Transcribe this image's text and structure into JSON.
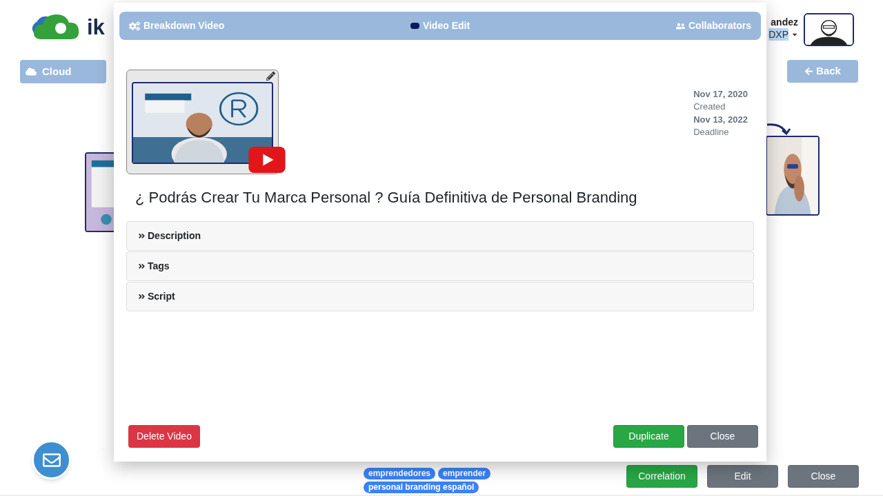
{
  "background": {
    "logo": {
      "text": "ik"
    },
    "user": {
      "name": "andez",
      "role": "DXP"
    },
    "cloud_button": "Cloud",
    "back_button": "Back",
    "tags": [
      "emprendedores",
      "emprender",
      "personal branding español"
    ],
    "buttons": [
      {
        "label": "Correlation",
        "kind": "success"
      },
      {
        "label": "Edit",
        "kind": "secondary"
      },
      {
        "label": "Close",
        "kind": "secondary"
      }
    ]
  },
  "modal": {
    "header_items": [
      "Breakdown Video",
      "Video Edit",
      "Collaborators"
    ],
    "dates": [
      {
        "value": "Nov 17, 2020",
        "label": "Created"
      },
      {
        "value": "Nov 13, 2022",
        "label": "Deadline"
      }
    ],
    "title": "¿ Podrás Crear Tu Marca Personal ? Guía Definitiva de Personal Branding",
    "sections": [
      "Description",
      "Tags",
      "Script"
    ],
    "delete_button": "Delete Video",
    "actions": [
      {
        "label": "Duplicate",
        "kind": "success"
      },
      {
        "label": "Close",
        "kind": "secondary"
      }
    ]
  }
}
